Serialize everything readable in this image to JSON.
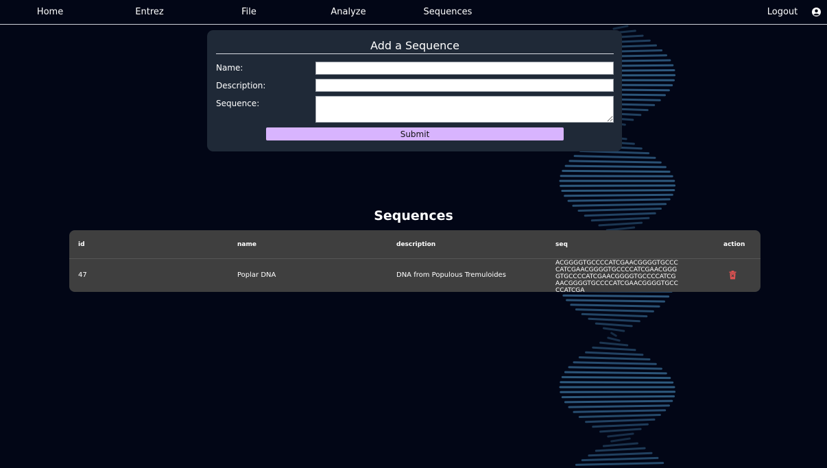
{
  "nav": {
    "items": [
      {
        "label": "Home"
      },
      {
        "label": "Entrez"
      },
      {
        "label": "File"
      },
      {
        "label": "Analyze"
      },
      {
        "label": "Sequences"
      }
    ],
    "logout_label": "Logout",
    "user_icon": "user-circle-icon"
  },
  "form": {
    "title": "Add a Sequence",
    "name_label": "Name:",
    "name_value": "",
    "description_label": "Description:",
    "description_value": "",
    "sequence_label": "Sequence:",
    "sequence_value": "",
    "submit_label": "Submit"
  },
  "sequences": {
    "title": "Sequences",
    "columns": [
      "id",
      "name",
      "description",
      "seq",
      "action"
    ],
    "rows": [
      {
        "id": "47",
        "name": "Poplar DNA",
        "description": "DNA from Populous Tremuloides",
        "seq": "ACGGGGTGCCCCATCGAACGGGGTGCCCCATCGAACGGGGTGCCCCATCGAACGGGGTGCCCCATCGAACGGGGTGCCCCATCGAACGGGGTGCCCCATCGAACGGGGTGCCCCATCGA",
        "action_icon": "trash-icon"
      }
    ]
  },
  "colors": {
    "background": "#020616",
    "form_card": "#1f2937",
    "submit_button": "#d8b4fe",
    "table_card": "#3f3f3f",
    "delete_icon": "#e05252",
    "helix": "#3a6f99"
  }
}
